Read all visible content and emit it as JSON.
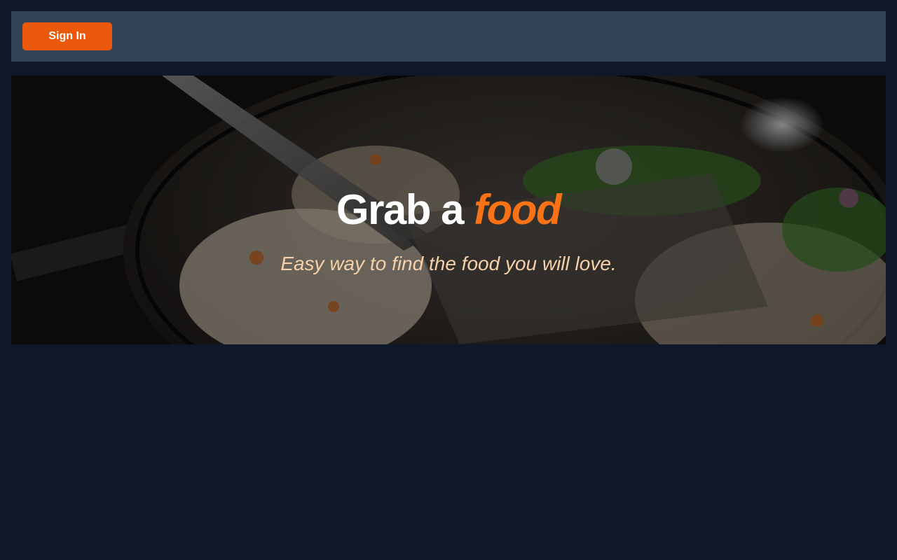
{
  "header": {
    "signin_label": "Sign In"
  },
  "hero": {
    "title_main": "Grab a",
    "title_accent": "food",
    "subtitle": "Easy way to find the food you will love."
  },
  "colors": {
    "background": "#0f172a",
    "header_bg": "#334155",
    "accent": "#f97316",
    "button": "#ea580c",
    "subtitle": "#f5d0a9"
  }
}
